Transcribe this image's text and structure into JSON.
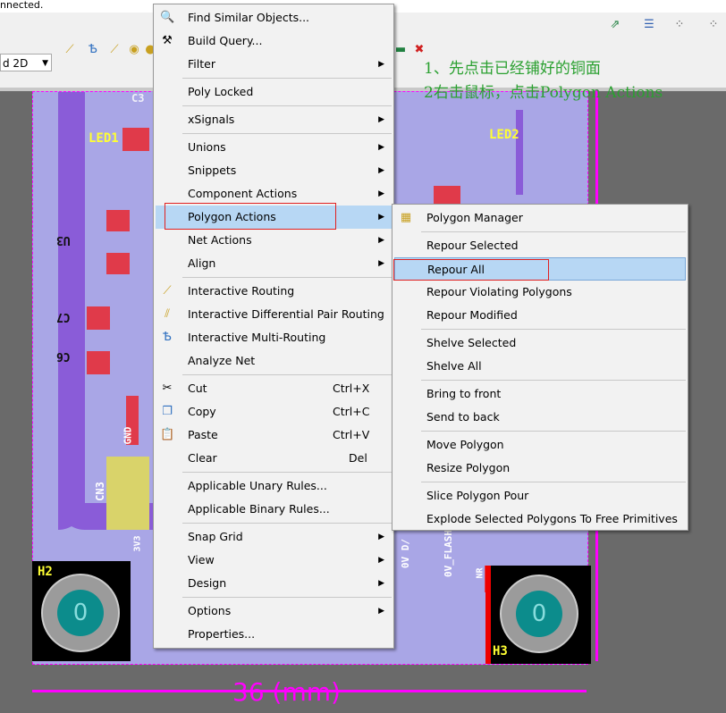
{
  "topbar": {
    "status": "nnected."
  },
  "toolbar": {
    "view_mode": "d 2D"
  },
  "annotation": {
    "line1": "1、先点击已经铺好的铜面",
    "line2": "2右击鼠标，点击Polygon Actions"
  },
  "pcb": {
    "labels": [
      "LED1",
      "LED2",
      "C3",
      "U3",
      "C7",
      "C6",
      "CN3",
      "GND",
      "H2",
      "H3",
      "3V3",
      "0V D/",
      "0V_FLASH",
      "NR"
    ],
    "hole_label": "0",
    "dimension": "36 (mm)"
  },
  "context_menu": {
    "items": [
      {
        "label": "Find Similar Objects...",
        "icon": "find-similar-icon"
      },
      {
        "label": "Build Query...",
        "icon": "hammer-icon"
      },
      {
        "label": "Filter",
        "submenu": true
      },
      {
        "label": "Poly Locked"
      },
      {
        "label": "xSignals",
        "submenu": true
      },
      {
        "label": "Unions",
        "submenu": true
      },
      {
        "label": "Snippets",
        "submenu": true
      },
      {
        "label": "Component Actions",
        "submenu": true
      },
      {
        "label": "Polygon Actions",
        "submenu": true
      },
      {
        "label": "Net Actions",
        "submenu": true
      },
      {
        "label": "Align",
        "submenu": true
      },
      {
        "label": "Interactive Routing",
        "icon": "route-icon"
      },
      {
        "label": "Interactive Differential Pair Routing",
        "icon": "diffpair-icon"
      },
      {
        "label": "Interactive Multi-Routing",
        "icon": "multiroute-icon"
      },
      {
        "label": "Analyze Net"
      },
      {
        "label": "Cut",
        "shortcut": "Ctrl+X",
        "icon": "scissors-icon"
      },
      {
        "label": "Copy",
        "shortcut": "Ctrl+C",
        "icon": "copy-icon"
      },
      {
        "label": "Paste",
        "shortcut": "Ctrl+V",
        "icon": "paste-icon"
      },
      {
        "label": "Clear",
        "shortcut": "Del"
      },
      {
        "label": "Applicable Unary Rules..."
      },
      {
        "label": "Applicable Binary Rules..."
      },
      {
        "label": "Snap Grid",
        "submenu": true
      },
      {
        "label": "View",
        "submenu": true
      },
      {
        "label": "Design",
        "submenu": true
      },
      {
        "label": "Options",
        "submenu": true
      },
      {
        "label": "Properties..."
      }
    ]
  },
  "polygon_submenu": {
    "items": [
      {
        "label": "Polygon Manager",
        "icon": "polygon-manager-icon"
      },
      {
        "label": "Repour Selected"
      },
      {
        "label": "Repour All"
      },
      {
        "label": "Repour Violating Polygons"
      },
      {
        "label": "Repour Modified"
      },
      {
        "label": "Shelve Selected"
      },
      {
        "label": "Shelve All"
      },
      {
        "label": "Bring to front"
      },
      {
        "label": "Send to back"
      },
      {
        "label": "Move Polygon"
      },
      {
        "label": "Resize Polygon"
      },
      {
        "label": "Slice Polygon Pour"
      },
      {
        "label": "Explode Selected Polygons To Free Primitives"
      }
    ]
  }
}
